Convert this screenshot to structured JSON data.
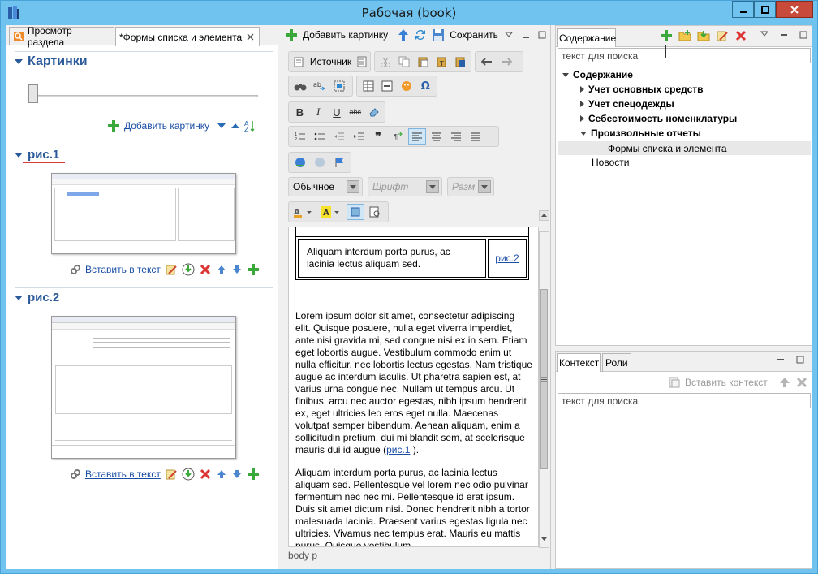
{
  "window": {
    "title": "Рабочая (book)"
  },
  "left": {
    "tabs": [
      {
        "label": "Просмотр раздела"
      },
      {
        "label": "*Формы списка и элемента"
      }
    ],
    "pictures_section": "Картинки",
    "add_picture": "Добавить картинку",
    "items": [
      {
        "title": "рис.1",
        "insert_label": "Вставить в текст"
      },
      {
        "title": "рис.2",
        "insert_label": "Вставить в текст"
      }
    ]
  },
  "middle": {
    "toolbar": {
      "add_picture": "Добавить картинку",
      "save": "Сохранить"
    },
    "source_label": "Источник",
    "style_value": "Обычное",
    "font_placeholder": "Шрифт",
    "size_placeholder": "Разм",
    "table_cell_text": "Aliquam interdum porta purus, ac lacinia lectus aliquam sed.",
    "table_cell_link": "рис.2",
    "para1": "Lorem ipsum dolor sit amet, consectetur adipiscing elit. Quisque posuere, nulla eget viverra imperdiet, ante nisi gravida mi, sed congue nisi ex in sem. Etiam eget lobortis augue. Vestibulum commodo enim ut nulla efficitur, nec lobortis lectus egestas. Nam tristique augue ac interdum iaculis. Ut pharetra sapien est, at varius urna congue nec. Nullam ut tempus arcu. Ut finibus, arcu nec auctor egestas, nibh ipsum hendrerit ex, eget ultricies leo eros eget nulla. Maecenas volutpat semper bibendum. Aenean aliquam, enim a sollicitudin pretium, dui mi blandit sem, at scelerisque mauris dui id augue (",
    "para1_link": "рис.1",
    "para1_end": " ).",
    "para2": "Aliquam interdum porta purus, ac lacinia lectus aliquam sed. Pellentesque vel lorem nec odio pulvinar fermentum nec nec mi. Pellentesque id erat ipsum. Duis sit amet dictum nisi. Donec hendrerit nibh a tortor malesuada lacinia. Praesent varius egestas ligula nec ultricies. Vivamus nec tempus erat. Mauris eu mattis purus. Quisque vestibulum",
    "status_path": "body  p"
  },
  "right": {
    "tab": "Содержание",
    "search_placeholder": "текст для поиска",
    "tree": [
      {
        "label": "Содержание"
      },
      {
        "label": "Учет основных средств"
      },
      {
        "label": "Учет спецодежды"
      },
      {
        "label": "Себестоимость номенклатуры"
      },
      {
        "label": "Произвольные отчеты"
      },
      {
        "label": "Формы списка и элемента"
      },
      {
        "label": "Новости"
      }
    ],
    "bottom_tabs": [
      {
        "label": "Контекст"
      },
      {
        "label": "Роли"
      }
    ],
    "insert_context": "Вставить контекст",
    "bottom_search_placeholder": "текст для поиска"
  }
}
